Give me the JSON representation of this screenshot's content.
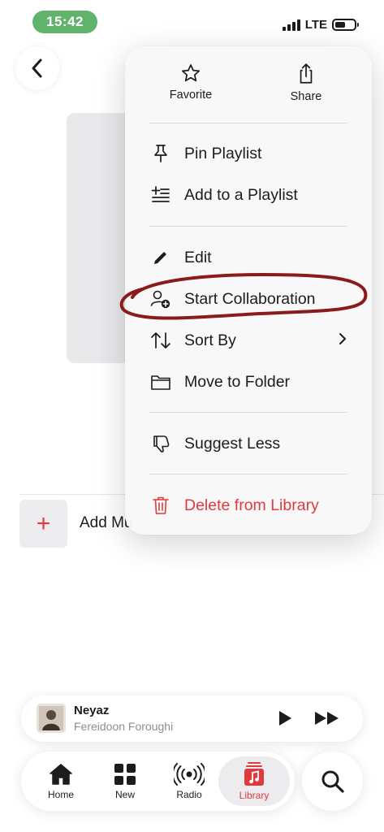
{
  "status_bar": {
    "time": "15:42",
    "network": "LTE"
  },
  "page": {
    "add_music_label": "Add Mu"
  },
  "context_menu": {
    "top_actions": [
      {
        "label": "Favorite",
        "icon": "star-icon"
      },
      {
        "label": "Share",
        "icon": "share-icon"
      }
    ],
    "items": [
      {
        "label": "Pin Playlist",
        "icon": "pin-icon"
      },
      {
        "label": "Add to a Playlist",
        "icon": "add-to-playlist-icon"
      },
      {
        "label": "Edit",
        "icon": "pencil-icon"
      },
      {
        "label": "Start Collaboration",
        "icon": "add-person-icon"
      },
      {
        "label": "Sort By",
        "icon": "sort-arrows-icon"
      },
      {
        "label": "Move to Folder",
        "icon": "folder-icon"
      },
      {
        "label": "Suggest Less",
        "icon": "thumbs-down-icon"
      },
      {
        "label": "Delete from Library",
        "icon": "trash-icon"
      }
    ],
    "annotation_color": "#8b1a1a"
  },
  "now_playing": {
    "title": "Neyaz",
    "artist": "Fereidoon Foroughi"
  },
  "tab_bar": {
    "tabs": [
      {
        "label": "Home",
        "icon": "home-icon"
      },
      {
        "label": "New",
        "icon": "grid-icon"
      },
      {
        "label": "Radio",
        "icon": "radio-icon"
      },
      {
        "label": "Library",
        "icon": "music-note-icon",
        "selected": true
      }
    ]
  },
  "colors": {
    "accent": "#e0393e",
    "status_pill": "#5fb36a"
  }
}
